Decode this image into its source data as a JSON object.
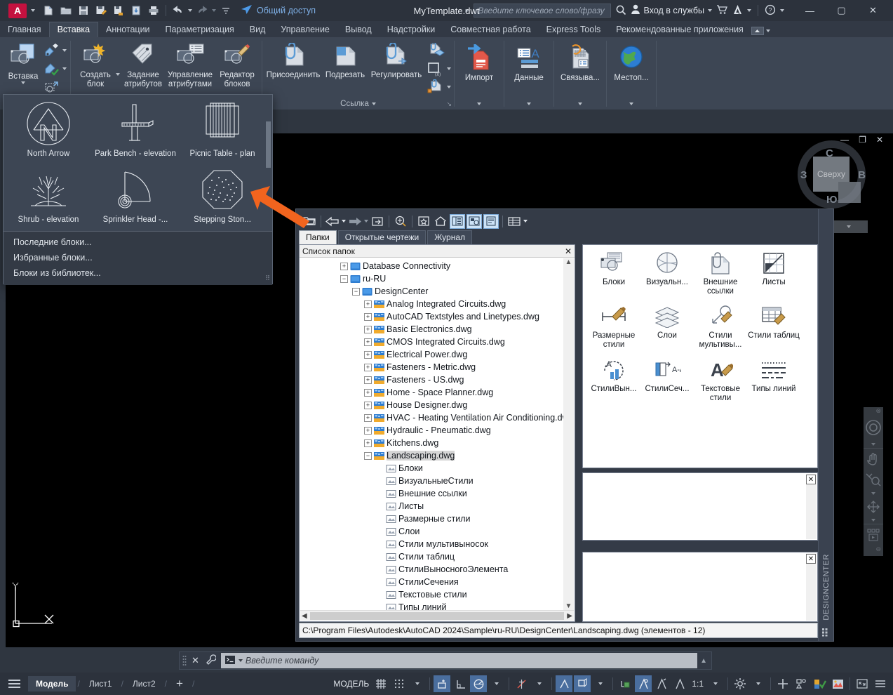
{
  "titlebar": {
    "app_letter": "A",
    "document_title": "MyTemplate.dwt",
    "share_label": "Общий доступ",
    "search_placeholder": "Введите ключевое слово/фразу",
    "signin_label": "Вход в службы",
    "qat_icons": [
      "new-file-icon",
      "open-folder-icon",
      "save-icon",
      "save-as-icon",
      "save-to-cloud-icon",
      "export-icon",
      "plot-icon",
      "undo-icon",
      "redo-icon",
      "qat-more-icon",
      "share-icon"
    ],
    "window_buttons": {
      "minimize": "—",
      "maximize": "▢",
      "close": "✕"
    }
  },
  "ribbon": {
    "tabs": [
      {
        "label": "Главная",
        "active": false
      },
      {
        "label": "Вставка",
        "active": true
      },
      {
        "label": "Аннотации",
        "active": false
      },
      {
        "label": "Параметризация",
        "active": false
      },
      {
        "label": "Вид",
        "active": false
      },
      {
        "label": "Управление",
        "active": false
      },
      {
        "label": "Вывод",
        "active": false
      },
      {
        "label": "Надстройки",
        "active": false
      },
      {
        "label": "Совместная работа",
        "active": false
      },
      {
        "label": "Express Tools",
        "active": false
      },
      {
        "label": "Рекомендованные приложения",
        "active": false
      }
    ],
    "panels": [
      {
        "name": "block",
        "title": "",
        "big_buttons": [
          {
            "label": "Вставка",
            "icon": "insert-block-icon",
            "has_dropdown": true
          },
          {
            "label": "Создать\nблок",
            "icon": "create-block-icon",
            "has_dropdown": true
          },
          {
            "label": "Задание\nатрибутов",
            "icon": "define-attributes-icon",
            "has_dropdown": false
          },
          {
            "label": "Управление\nатрибутами",
            "icon": "manage-attributes-icon",
            "has_dropdown": false
          },
          {
            "label": "Редактор\nблоков",
            "icon": "block-editor-icon",
            "has_dropdown": false
          }
        ],
        "small_buttons": [
          {
            "icon": "edit-block-attr-icon"
          },
          {
            "icon": "sync-block-attr-icon"
          },
          {
            "icon": "retain-attr-icon"
          }
        ]
      },
      {
        "name": "reference",
        "title": "Ссылка",
        "big_buttons": [
          {
            "label": "Присоединить",
            "icon": "attach-reference-icon"
          },
          {
            "label": "Подрезать",
            "icon": "clip-reference-icon"
          },
          {
            "label": "Регулировать",
            "icon": "adjust-reference-icon"
          }
        ],
        "small_buttons": [
          {
            "icon": "underlay-layers-icon"
          },
          {
            "icon": "frames-vary-icon"
          },
          {
            "icon": "snap-to-underlay-icon"
          }
        ]
      },
      {
        "name": "import-data",
        "buttons": [
          {
            "label": "Импорт",
            "icon": "import-icon"
          },
          {
            "label": "Данные",
            "icon": "data-link-icon"
          },
          {
            "label": "Связыва...",
            "icon": "data-extraction-icon"
          },
          {
            "label": "Местоп...",
            "icon": "geolocation-icon"
          }
        ]
      }
    ]
  },
  "block_gallery": {
    "items": [
      {
        "label": "North Arrow",
        "icon": "north-arrow-block-icon"
      },
      {
        "label": "Park Bench - elevation",
        "icon": "park-bench-block-icon"
      },
      {
        "label": "Picnic Table - plan",
        "icon": "picnic-table-block-icon"
      },
      {
        "label": "Shrub - elevation",
        "icon": "shrub-block-icon"
      },
      {
        "label": "Sprinkler Head -...",
        "icon": "sprinkler-head-block-icon"
      },
      {
        "label": "Stepping Ston...",
        "icon": "stepping-stone-block-icon"
      }
    ],
    "menu": [
      "Последние блоки...",
      "Избранные блоки...",
      "Блоки из библиотек..."
    ]
  },
  "viewcube": {
    "face_label": "Сверху",
    "compass": {
      "north": "C",
      "east": "B",
      "south": "Ю",
      "west": "З"
    }
  },
  "designcenter": {
    "title": "DESIGNCENTER",
    "toolbar_icons": [
      "load-icon",
      "back-icon",
      "back-dropdown-icon",
      "forward-icon",
      "forward-dropdown-icon",
      "up-icon",
      "search-icon",
      "favorites-icon",
      "home-icon",
      "tree-view-toggle-icon",
      "preview-toggle-icon",
      "description-toggle-icon",
      "views-icon",
      "views-dropdown-icon"
    ],
    "tabs": [
      {
        "label": "Папки",
        "active": true
      },
      {
        "label": "Открытые чертежи",
        "active": false
      },
      {
        "label": "Журнал",
        "active": false
      }
    ],
    "tree_header": "Список папок",
    "tree": [
      {
        "label": "Database Connectivity",
        "depth": 3,
        "expander": "+",
        "icon": "folder-icon",
        "selected": false
      },
      {
        "label": "ru-RU",
        "depth": 3,
        "expander": "−",
        "icon": "folder-icon",
        "selected": false
      },
      {
        "label": "DesignCenter",
        "depth": 4,
        "expander": "−",
        "icon": "folder-icon",
        "selected": false
      },
      {
        "label": "Analog Integrated Circuits.dwg",
        "depth": 5,
        "expander": "+",
        "icon": "dwg-icon",
        "selected": false
      },
      {
        "label": "AutoCAD Textstyles and Linetypes.dwg",
        "depth": 5,
        "expander": "+",
        "icon": "dwg-icon",
        "selected": false
      },
      {
        "label": "Basic Electronics.dwg",
        "depth": 5,
        "expander": "+",
        "icon": "dwg-icon",
        "selected": false
      },
      {
        "label": "CMOS Integrated Circuits.dwg",
        "depth": 5,
        "expander": "+",
        "icon": "dwg-icon",
        "selected": false
      },
      {
        "label": "Electrical Power.dwg",
        "depth": 5,
        "expander": "+",
        "icon": "dwg-icon",
        "selected": false
      },
      {
        "label": "Fasteners - Metric.dwg",
        "depth": 5,
        "expander": "+",
        "icon": "dwg-icon",
        "selected": false
      },
      {
        "label": "Fasteners - US.dwg",
        "depth": 5,
        "expander": "+",
        "icon": "dwg-icon",
        "selected": false
      },
      {
        "label": "Home - Space Planner.dwg",
        "depth": 5,
        "expander": "+",
        "icon": "dwg-icon",
        "selected": false
      },
      {
        "label": "House Designer.dwg",
        "depth": 5,
        "expander": "+",
        "icon": "dwg-icon",
        "selected": false
      },
      {
        "label": "HVAC - Heating Ventilation Air Conditioning.dwg",
        "depth": 5,
        "expander": "+",
        "icon": "dwg-icon",
        "selected": false
      },
      {
        "label": "Hydraulic - Pneumatic.dwg",
        "depth": 5,
        "expander": "+",
        "icon": "dwg-icon",
        "selected": false
      },
      {
        "label": "Kitchens.dwg",
        "depth": 5,
        "expander": "+",
        "icon": "dwg-icon",
        "selected": false
      },
      {
        "label": "Landscaping.dwg",
        "depth": 5,
        "expander": "−",
        "icon": "dwg-icon",
        "selected": true
      },
      {
        "label": "Блоки",
        "depth": 6,
        "expander": "",
        "icon": "blocks-icon",
        "selected": false
      },
      {
        "label": "ВизуальныеСтили",
        "depth": 6,
        "expander": "",
        "icon": "visual-styles-icon",
        "selected": false
      },
      {
        "label": "Внешние ссылки",
        "depth": 6,
        "expander": "",
        "icon": "xrefs-icon",
        "selected": false
      },
      {
        "label": "Листы",
        "depth": 6,
        "expander": "",
        "icon": "layouts-icon",
        "selected": false
      },
      {
        "label": "Размерные стили",
        "depth": 6,
        "expander": "",
        "icon": "dim-styles-icon",
        "selected": false
      },
      {
        "label": "Слои",
        "depth": 6,
        "expander": "",
        "icon": "layers-icon",
        "selected": false
      },
      {
        "label": "Стили мультивыносок",
        "depth": 6,
        "expander": "",
        "icon": "mleader-styles-icon",
        "selected": false
      },
      {
        "label": "Стили таблиц",
        "depth": 6,
        "expander": "",
        "icon": "table-styles-icon",
        "selected": false
      },
      {
        "label": "СтилиВыносногоЭлемента",
        "depth": 6,
        "expander": "",
        "icon": "detail-view-styles-icon",
        "selected": false
      },
      {
        "label": "СтилиСечения",
        "depth": 6,
        "expander": "",
        "icon": "section-view-styles-icon",
        "selected": false
      },
      {
        "label": "Текстовые стили",
        "depth": 6,
        "expander": "",
        "icon": "text-styles-icon",
        "selected": false
      },
      {
        "label": "Типы линий",
        "depth": 6,
        "expander": "",
        "icon": "linetypes-icon",
        "selected": false
      }
    ],
    "content_items": [
      {
        "label": "Блоки",
        "icon": "blocks-icon"
      },
      {
        "label": "Визуальн...",
        "icon": "visual-styles-icon"
      },
      {
        "label": "Внешние ссылки",
        "icon": "xrefs-icon"
      },
      {
        "label": "Листы",
        "icon": "layouts-icon"
      },
      {
        "label": "Размерные стили",
        "icon": "dim-styles-icon"
      },
      {
        "label": "Слои",
        "icon": "layers-icon"
      },
      {
        "label": "Стили мультивы...",
        "icon": "mleader-styles-icon"
      },
      {
        "label": "Стили таблиц",
        "icon": "table-styles-icon"
      },
      {
        "label": "СтилиВын...",
        "icon": "detail-view-styles-icon"
      },
      {
        "label": "СтилиСеч...",
        "icon": "section-view-styles-icon"
      },
      {
        "label": "Текстовые стили",
        "icon": "text-styles-icon"
      },
      {
        "label": "Типы линий",
        "icon": "linetypes-icon"
      }
    ],
    "status_path": "C:\\Program Files\\Autodesk\\AutoCAD 2024\\Sample\\ru-RU\\DesignCenter\\Landscaping.dwg (элементов  - 12)"
  },
  "command_line": {
    "placeholder": "Введите команду",
    "close_icon": "close-icon",
    "customize_icon": "wrench-icon",
    "prompt_icon": "command-prompt-icon"
  },
  "statusbar": {
    "menu_icon": "hamburger-icon",
    "layout_tabs": [
      {
        "label": "Модель",
        "active": true
      },
      {
        "label": "Лист1",
        "active": false
      },
      {
        "label": "Лист2",
        "active": false
      }
    ],
    "add_layout": "+",
    "space_label": "МОДЕЛЬ",
    "scale_label": "1:1",
    "right_buttons": [
      {
        "name": "grid-display",
        "icon": "grid-icon",
        "on": false
      },
      {
        "name": "snap-mode",
        "icon": "snap-icon",
        "on": false
      },
      {
        "name": "snap-dropdown",
        "icon": "chevron-down-icon",
        "on": false
      },
      {
        "name": "infer-constraints",
        "icon": "infer-constraints-icon",
        "on": true
      },
      {
        "name": "ortho-mode",
        "icon": "ortho-icon",
        "on": false
      },
      {
        "name": "polar-tracking",
        "icon": "polar-icon",
        "on": true
      },
      {
        "name": "polar-dropdown",
        "icon": "chevron-down-icon",
        "on": false
      },
      {
        "name": "object-snap-tracking",
        "icon": "osnap-tracking-icon",
        "on": false
      },
      {
        "name": "otrack-dropdown",
        "icon": "chevron-down-icon",
        "on": false
      },
      {
        "name": "object-snap",
        "icon": "object-snap-icon",
        "on": true
      },
      {
        "name": "3d-object-snap",
        "icon": "3d-osnap-icon",
        "on": true
      },
      {
        "name": "osnap-dropdown",
        "icon": "chevron-down-icon",
        "on": false
      },
      {
        "name": "dynamic-ucs",
        "icon": "dynamic-ucs-icon",
        "on": false
      },
      {
        "name": "dynamic-input",
        "icon": "dynamic-input-icon",
        "on": true
      },
      {
        "name": "lineweight",
        "icon": "lineweight-icon",
        "on": false
      },
      {
        "name": "transparency",
        "icon": "transparency-icon",
        "on": false
      },
      {
        "name": "selection-cycling",
        "icon": "selection-cycling-icon",
        "on": false
      },
      {
        "name": "annotation-visibility",
        "icon": "annotation-visibility-icon",
        "on": false
      },
      {
        "name": "autoscale",
        "icon": "autoscale-icon",
        "on": false
      },
      {
        "name": "isolate-objects",
        "icon": "isolate-objects-icon",
        "on": false
      },
      {
        "name": "hardware-acceleration",
        "icon": "hardware-accel-icon",
        "on": false
      },
      {
        "name": "units-display",
        "icon": "units-icon",
        "on": false
      },
      {
        "name": "clean-screen",
        "icon": "clean-screen-icon",
        "on": false
      },
      {
        "name": "customization",
        "icon": "customization-icon",
        "on": false
      }
    ]
  },
  "annotation": {
    "arrow": "orange-pointer-arrow"
  },
  "colors": {
    "ribbon_bg": "#3d4654",
    "titlebar_bg": "#2c323c",
    "canvas_bg": "#000000",
    "accent_red": "#c4113f",
    "accent_blue": "#7fb1e8",
    "arrow_orange": "#f2641e",
    "status_on": "#4a6e9e"
  }
}
